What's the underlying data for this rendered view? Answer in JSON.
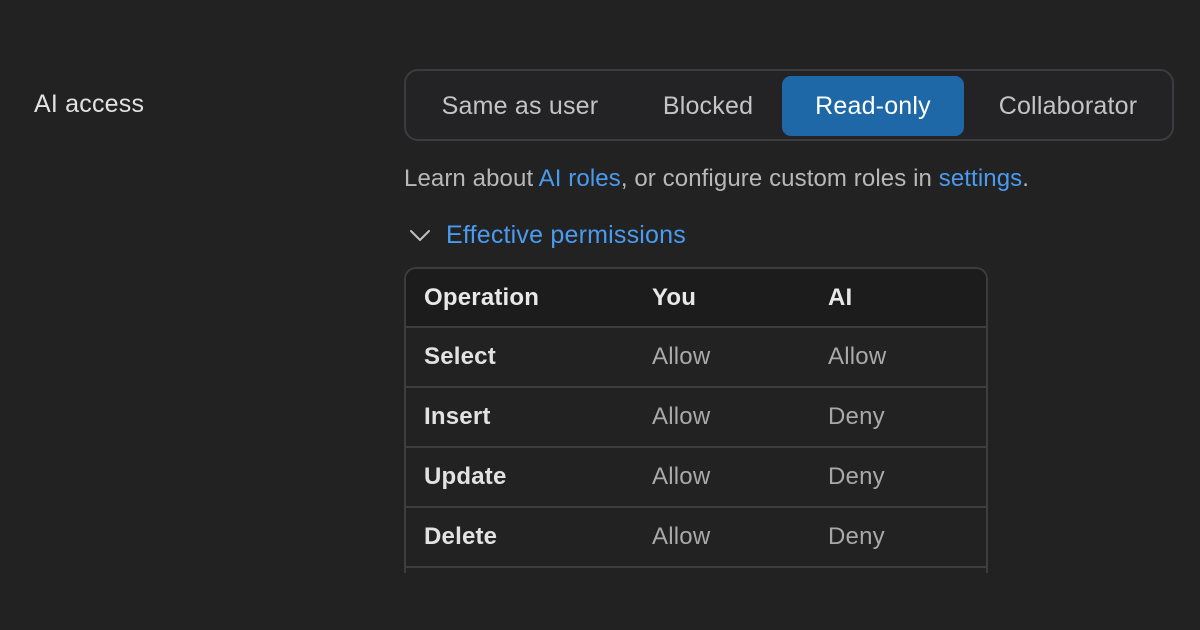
{
  "section": {
    "label": "AI access"
  },
  "access_modes": {
    "options": [
      "Same as user",
      "Blocked",
      "Read-only",
      "Collaborator"
    ],
    "selected": "Read-only"
  },
  "help": {
    "prefix": "Learn about ",
    "ai_roles_link": "AI roles",
    "middle": ", or configure custom roles in ",
    "settings_link": "settings",
    "suffix": "."
  },
  "permissions": {
    "toggle_label": "Effective permissions",
    "expanded": true,
    "columns": [
      "Operation",
      "You",
      "AI"
    ],
    "rows": [
      {
        "operation": "Select",
        "you": "Allow",
        "ai": "Allow"
      },
      {
        "operation": "Insert",
        "you": "Allow",
        "ai": "Deny"
      },
      {
        "operation": "Update",
        "you": "Allow",
        "ai": "Deny"
      },
      {
        "operation": "Delete",
        "you": "Allow",
        "ai": "Deny"
      }
    ]
  },
  "colors": {
    "background": "#222223",
    "accent_selected": "#1f68a7",
    "link": "#4a9bf0",
    "border": "#3d3d3f"
  },
  "icons": {
    "disclosure": "chevron-down-icon"
  }
}
